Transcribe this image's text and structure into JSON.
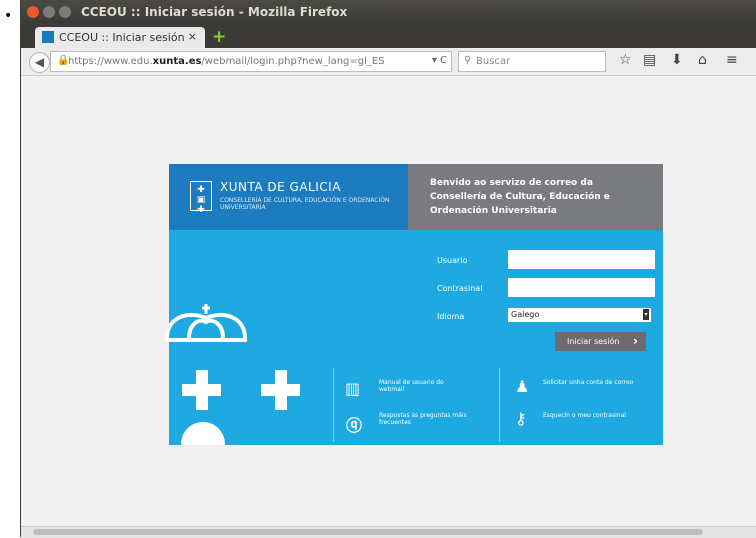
{
  "window": {
    "title": "CCEOU :: Iniciar sesión - Mozilla Firefox"
  },
  "tab": {
    "label": "CCEOU :: Iniciar sesión",
    "close": "×",
    "new_tab": "+"
  },
  "nav": {
    "url_host": "https://www.edu.",
    "url_bold": "xunta.es",
    "url_path": "/webmail/login.php?new_lang=gl_ES",
    "url_ctrl": "▾ C",
    "search_placeholder": "Buscar"
  },
  "brand": {
    "name": "XUNTA DE GALICIA",
    "department": "CONSELLERÍA DE CULTURA, EDUCACIÓN E ORDENACIÓN UNIVERSITARIA"
  },
  "welcome": "Benvido ao servizo de correo da Consellería de Cultura, Educación e Ordenación Universitaria",
  "form": {
    "user_label": "Usuario",
    "password_label": "Contrasinal",
    "language_label": "Idioma",
    "language_value": "Galego",
    "submit_label": "Iniciar sesión"
  },
  "links": {
    "manual": "Manual de usuario do webmail",
    "faq": "Respostas ás preguntas máis frecuentes",
    "request_account": "Solicitar unha conta de correo",
    "forgot_password": "Esquecín o meu contrasinal"
  },
  "colors": {
    "panel": "#1ea9e1",
    "logo_box": "#1c7cbf",
    "welcome_box": "#7a7b7e"
  }
}
